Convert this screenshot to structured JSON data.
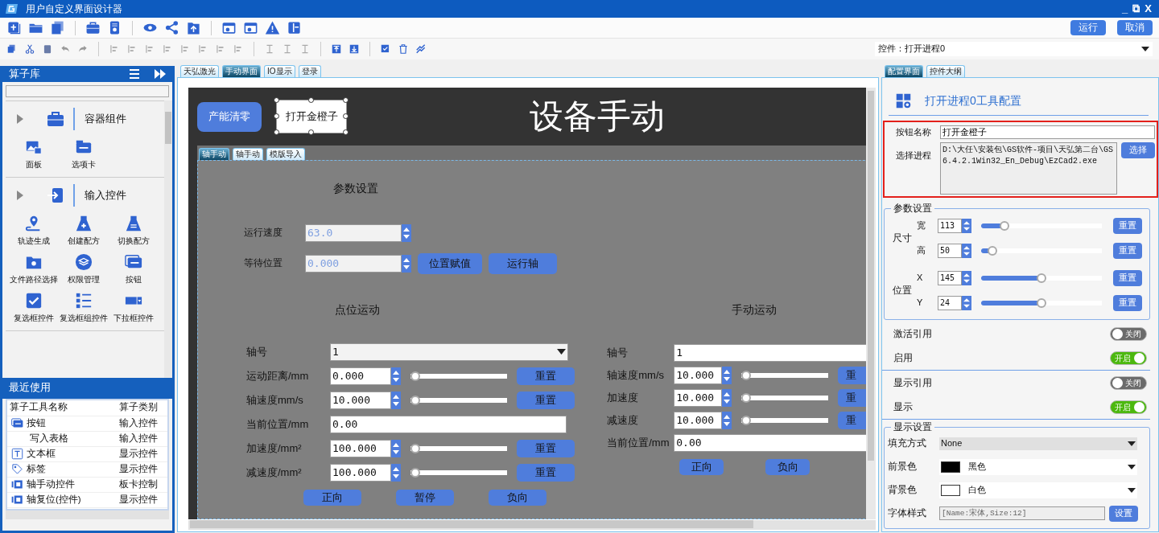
{
  "window": {
    "title": "用户自定义界面设计器",
    "controls": [
      "_",
      "⧉",
      "X"
    ]
  },
  "toolbar": {
    "buttons": [
      "运行",
      "取消"
    ]
  },
  "control_picker": {
    "value": "控件：打开进程0"
  },
  "library": {
    "title": "算子库",
    "groups": [
      {
        "label": "容器组件",
        "kind": "briefcase",
        "items": [
          {
            "label": "面板",
            "kind": "gallery"
          },
          {
            "label": "选项卡",
            "kind": "tab"
          }
        ]
      },
      {
        "label": "输入控件",
        "kind": "enter",
        "items": [
          {
            "label": "轨迹生成",
            "kind": "pin"
          },
          {
            "label": "创建配方",
            "kind": "flask-plus"
          },
          {
            "label": "切换配方",
            "kind": "flask-swap"
          },
          {
            "label": "文件路径选择",
            "kind": "folder"
          },
          {
            "label": "权限管理",
            "kind": "layers"
          },
          {
            "label": "按钮",
            "kind": "button"
          },
          {
            "label": "复选框控件",
            "kind": "check"
          },
          {
            "label": "复选框组控件",
            "kind": "checklist"
          },
          {
            "label": "下拉框控件",
            "kind": "dropdown"
          }
        ]
      }
    ]
  },
  "recent": {
    "title": "最近使用",
    "columns": [
      "算子工具名称",
      "算子类别"
    ],
    "rows": [
      {
        "name": "按钮",
        "category": "输入控件",
        "kind": "button"
      },
      {
        "name": "写入表格",
        "category": "输入控件",
        "kind": "none"
      },
      {
        "name": "文本框",
        "category": "显示控件",
        "kind": "text"
      },
      {
        "name": "标签",
        "category": "显示控件",
        "kind": "tag"
      },
      {
        "name": "轴手动控件",
        "category": "板卡控制",
        "kind": "axis"
      },
      {
        "name": "轴复位(控件)",
        "category": "显示控件",
        "kind": "axis"
      }
    ]
  },
  "designer": {
    "tabs": [
      {
        "label": "天弘激光",
        "selected": false
      },
      {
        "label": "手动界面",
        "selected": true
      },
      {
        "label": "IO显示",
        "selected": false
      },
      {
        "label": "登录",
        "selected": false
      }
    ],
    "canvas": {
      "buttons": [
        {
          "label": "产能清零",
          "selected": false
        },
        {
          "label": "打开金橙子",
          "selected": true
        }
      ],
      "title": "设备手动",
      "tabs": [
        {
          "label": "轴手动",
          "selected": true
        },
        {
          "label": "轴手动",
          "selected": false
        },
        {
          "label": "模版导入",
          "selected": false
        }
      ],
      "params": {
        "title": "参数设置",
        "rows": [
          {
            "label": "运行速度",
            "value": "63.0",
            "disabled": true
          },
          {
            "label": "等待位置",
            "value": "0.000",
            "disabled": true
          }
        ],
        "buttons": [
          "位置赋值",
          "运行轴"
        ]
      },
      "sections": [
        {
          "title": "点位运动",
          "rows": [
            {
              "kind": "select",
              "label": "轴号",
              "value": "1"
            },
            {
              "kind": "spin",
              "label": "运动距离/mm",
              "value": "0.000",
              "level": 0,
              "button": "重置"
            },
            {
              "kind": "spin",
              "label": "轴速度mm/s",
              "value": "10.000",
              "level": 0,
              "button": "重置"
            },
            {
              "kind": "text",
              "label": "当前位置/mm",
              "value": "0.00"
            },
            {
              "kind": "spin",
              "label": "加速度/mm²",
              "value": "100.000",
              "level": 0,
              "button": "重置"
            },
            {
              "kind": "spin",
              "label": "减速度/mm²",
              "value": "100.000",
              "level": 0,
              "button": "重置"
            }
          ],
          "buttons": [
            "正向",
            "暂停",
            "负向"
          ]
        },
        {
          "title": "手动运动",
          "rows": [
            {
              "kind": "text",
              "label": "轴号",
              "value": "1"
            },
            {
              "kind": "spin",
              "label": "轴速度mm/s",
              "value": "10.000",
              "level": 0,
              "button": "重"
            },
            {
              "kind": "spin",
              "label": "加速度",
              "value": "10.000",
              "level": 0,
              "button": "重"
            },
            {
              "kind": "spin",
              "label": "减速度",
              "value": "10.000",
              "level": 0,
              "button": "重"
            },
            {
              "kind": "text",
              "label": "当前位置/mm",
              "value": "0.00"
            }
          ],
          "buttons": [
            "正向",
            "负向"
          ]
        }
      ]
    }
  },
  "properties": {
    "tabs": [
      {
        "label": "配置界面",
        "selected": true
      },
      {
        "label": "控件大纲",
        "selected": false
      }
    ],
    "title": "打开进程0工具配置",
    "button_name": {
      "label": "按钮名称",
      "value": "打开金橙子"
    },
    "process": {
      "label": "选择进程",
      "value": "D:\\大任\\安装包\\GS软件-项目\\天弘第二台\\GS6.4.2.1Win32_En_Debug\\EzCad2.exe",
      "button": "选择"
    },
    "params": {
      "title": "参数设置",
      "groups": [
        {
          "label": "尺寸",
          "rows": [
            {
              "label": "宽",
              "value": "113",
              "level": 0.17,
              "button": "重置"
            },
            {
              "label": "高",
              "value": "50",
              "level": 0.06,
              "button": "重置"
            }
          ]
        },
        {
          "label": "位置",
          "rows": [
            {
              "label": "X",
              "value": "145",
              "level": 0.5,
              "button": "重置"
            },
            {
              "label": "Y",
              "value": "24",
              "level": 0.5,
              "button": "重置"
            }
          ]
        }
      ]
    },
    "switches": [
      {
        "label": "激活引用",
        "on": false,
        "text": "关闭"
      },
      {
        "label": "启用",
        "on": true,
        "text": "开启"
      },
      {
        "label": "显示引用",
        "on": false,
        "text": "关闭"
      },
      {
        "label": "显示",
        "on": true,
        "text": "开启"
      }
    ],
    "display": {
      "title": "显示设置",
      "rows": [
        {
          "kind": "select",
          "label": "填充方式",
          "value": "None"
        },
        {
          "kind": "color",
          "label": "前景色",
          "value": "黑色",
          "color": "#000000"
        },
        {
          "kind": "color",
          "label": "背景色",
          "value": "白色",
          "color": "#ffffff"
        },
        {
          "kind": "font",
          "label": "字体样式",
          "value": "[Name:宋体,Size:12]",
          "button": "设置"
        }
      ]
    }
  }
}
